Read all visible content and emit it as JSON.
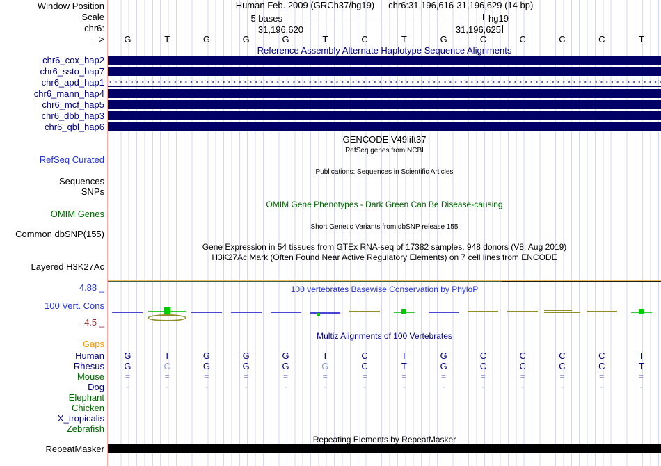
{
  "colors": {
    "haplotype_bar_navy": "#000066",
    "navy_text": "#000080",
    "blue_text": "#2233cc",
    "green_text": "#006600",
    "orange_text": "#ff9900",
    "dark_red_text": "#993333",
    "grid_line": "#d7d7ee",
    "left_border_pink": "#ffaaaa",
    "h3k27ac_gold": "#eebb55",
    "h3k27ac_teal": "#336655",
    "h3k27ac_dark": "#1a1a1a",
    "conservation_blue": "#4747d1",
    "conservation_olive": "#8f8f26",
    "conservation_green": "#00cc00",
    "muted_base": "#8c9ad6",
    "repeat_bar_black": "#000000"
  },
  "header": {
    "assembly_title": "Human Feb. 2009 (GRCh37/hg19)",
    "position_title": "chr6:31,196,616-31,196,629 (14 bp)",
    "window_position_label": "Window Position",
    "scale_label": "Scale",
    "chrom_label": "chr6:",
    "strand_label": "--->",
    "scale_bar_label": "5 bases",
    "assembly_label": "hg19",
    "coord_left": "31,196,620",
    "coord_right": "31,196,625"
  },
  "sequence": {
    "bases": [
      "G",
      "T",
      "G",
      "G",
      "G",
      "T",
      "C",
      "T",
      "G",
      "C",
      "C",
      "C",
      "C",
      "T"
    ]
  },
  "alt_haplotypes": {
    "title": "Reference Assembly Alternate Haplotype Sequence Alignments",
    "tracks": [
      {
        "label": "chr6_cox_hap2",
        "style": "solid"
      },
      {
        "label": "chr6_ssto_hap7",
        "style": "solid"
      },
      {
        "label": "chr6_apd_hap1",
        "style": "chevron"
      },
      {
        "label": "chr6_mann_hap4",
        "style": "solid"
      },
      {
        "label": "chr6_mcf_hap5",
        "style": "solid"
      },
      {
        "label": "chr6_dbb_hap3",
        "style": "solid"
      },
      {
        "label": "chr6_qbl_hap6",
        "style": "solid"
      }
    ]
  },
  "gene_tracks": {
    "gencode_title": "GENCODE V49lift37",
    "refseq_subtitle": "RefSeq genes from NCBI",
    "refseq_label": "RefSeq Curated",
    "publications_title": "Publications: Sequences in Scientific Articles",
    "sequences_label": "Sequences",
    "snps_label": "SNPs",
    "omim_title": "OMIM Gene Phenotypes - Dark Green Can Be Disease-causing",
    "omim_label": "OMIM Genes",
    "dbsnp_title": "Short Genetic Variants from dbSNP release 155",
    "dbsnp_label": "Common dbSNP(155)",
    "gtex_title": "Gene Expression in 54 tissues from GTEx RNA-seq of 17382 samples, 948 donors (V8, Aug 2019)",
    "h3k27ac_title": "H3K27Ac Mark (Often Found Near Active Regulatory Elements) on 7 cell lines from ENCODE",
    "h3k27ac_label": "Layered H3K27Ac"
  },
  "conservation": {
    "title": "100 vertebrates Basewise Conservation by PhyloP",
    "label": "100 Vert. Cons",
    "axis_max": "4.88 _",
    "axis_min": "-4.5 _",
    "columns": [
      "blue",
      "green_peak",
      "blue",
      "blue",
      "blue",
      "blue_dot",
      "olive",
      "green_mark",
      "blue",
      "olive",
      "olive",
      "olive_double",
      "olive",
      "green_mark"
    ]
  },
  "multiz": {
    "title": "Multiz Alignments of 100 Vertebrates",
    "gaps_label": "Gaps",
    "species": [
      {
        "label": "Human",
        "label_color": "navy",
        "cell_style": "base",
        "cells": [
          "G",
          "T",
          "G",
          "G",
          "G",
          "T",
          "C",
          "T",
          "G",
          "C",
          "C",
          "C",
          "C",
          "T"
        ],
        "muted_indices": []
      },
      {
        "label": "Rhesus",
        "label_color": "navy",
        "cell_style": "base",
        "cells": [
          "G",
          "C",
          "G",
          "G",
          "G",
          "G",
          "C",
          "T",
          "G",
          "C",
          "C",
          "C",
          "C",
          "T"
        ],
        "muted_indices": [
          1,
          5
        ]
      },
      {
        "label": "Mouse",
        "label_color": "green",
        "cell_style": "gap",
        "cells": [
          "=",
          "=",
          "=",
          "=",
          "=",
          "=",
          "=",
          "=",
          "=",
          "=",
          "=",
          "=",
          "=",
          "="
        ],
        "muted_indices": []
      },
      {
        "label": "Dog",
        "label_color": "navy",
        "cell_style": "gap2",
        "cells": [
          "-",
          "-",
          "-",
          "-",
          "-",
          "-",
          "-",
          "-",
          "-",
          "-",
          "-",
          "-",
          "-",
          "-"
        ],
        "muted_indices": []
      },
      {
        "label": "Elephant",
        "label_color": "green",
        "cell_style": "none",
        "cells": [],
        "muted_indices": []
      },
      {
        "label": "Chicken",
        "label_color": "green",
        "cell_style": "none",
        "cells": [],
        "muted_indices": []
      },
      {
        "label": "X_tropicalis",
        "label_color": "navy",
        "cell_style": "none",
        "cells": [],
        "muted_indices": []
      },
      {
        "label": "Zebrafish",
        "label_color": "green",
        "cell_style": "none",
        "cells": [],
        "muted_indices": []
      }
    ]
  },
  "repeatmasker": {
    "title": "Repeating Elements by RepeatMasker",
    "label": "RepeatMasker"
  }
}
